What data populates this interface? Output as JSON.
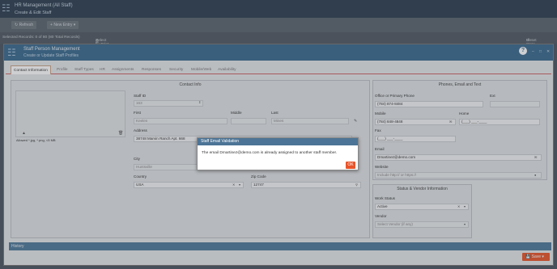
{
  "app": {
    "title": "HR Management (All Staff)",
    "subtitle": "Create & Edit Staff",
    "logo_icon": "org-chart-icon"
  },
  "toolbar": {
    "refresh_label": "Refresh",
    "new_entry_label": "New Entry"
  },
  "selection_bar": {
    "records_text": "Selected Records: 0 of 80 (80 Total Records)",
    "print_text": "Select by Print all Records",
    "reset_text": "Reset State"
  },
  "modal": {
    "title": "Staff Person Management",
    "subtitle": "Create or Update Staff Profiles",
    "help_label": "?",
    "tabs": [
      {
        "label": "Contact Information",
        "active": true
      },
      {
        "label": "Profile"
      },
      {
        "label": "Staff Types"
      },
      {
        "label": "HR"
      },
      {
        "label": "Assignments"
      },
      {
        "label": "Responses"
      },
      {
        "label": "Security"
      },
      {
        "label": "Mobile/Web"
      },
      {
        "label": "Availability"
      }
    ]
  },
  "contact_info": {
    "title": "Contact Info",
    "photo_hint": "Allowed *.jpg, *.png, <5 MB",
    "staff_id_label": "Staff ID",
    "staff_id_value": "163",
    "first_label": "First",
    "first_value": "Keelen",
    "middle_label": "Middle",
    "last_label": "Last",
    "last_value": "Mines",
    "address_label": "Address",
    "address_value": "38748 Marvin Ranch Apt. 668",
    "city_label": "City",
    "city_value": "Huntsville",
    "country_label": "Country",
    "country_value": "USA",
    "zip_label": "Zip Code",
    "zip_value": "12747"
  },
  "phone_email": {
    "title": "Phones, Email and Text",
    "office_label": "Office or Primary Phone",
    "office_value": "(784) 874-8484",
    "ext_label": "Ext",
    "mobile_label": "Mobile",
    "mobile_value": "(784) 848-4848",
    "home_label": "Home",
    "home_value": "(___) ___-____",
    "fax_label": "Fax",
    "fax_value": "(___) ___-____",
    "email_label": "Email",
    "email_value": "Dmartinez@demo.com",
    "website_label": "Website",
    "website_placeholder": "Include http:// or https://"
  },
  "status_vendor": {
    "title": "Status & Vendor Information",
    "work_status_label": "Work Status",
    "work_status_value": "Active",
    "vendor_label": "Vendor",
    "vendor_placeholder": "Select Vendor (if any)"
  },
  "history": {
    "label": "History"
  },
  "save": {
    "label": "Save"
  },
  "dialog": {
    "title": "Staff Email Validation",
    "message": "The email Dmartinez@demo.com is already assigned to another staff member.",
    "ok_label": "OK"
  },
  "colors": {
    "accent": "#e8542a",
    "header": "#2d3e50",
    "modal_header": "#3a6a8e"
  }
}
